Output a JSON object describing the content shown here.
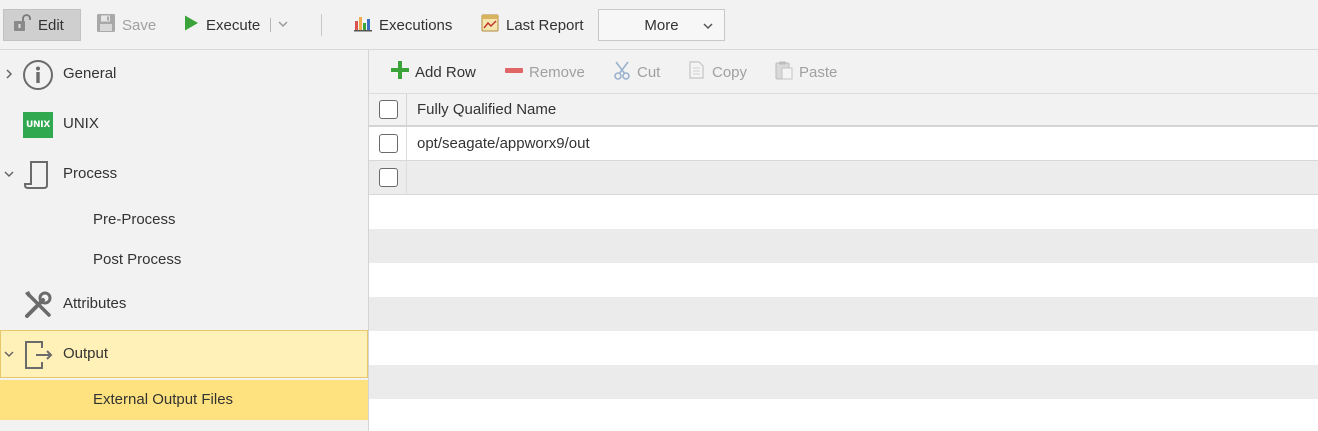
{
  "toolbar": {
    "edit": "Edit",
    "save": "Save",
    "execute": "Execute",
    "executions": "Executions",
    "last_report": "Last Report",
    "more": "More"
  },
  "sidebar": {
    "items": [
      {
        "label": "General",
        "icon": "info-icon"
      },
      {
        "label": "UNIX",
        "icon": "unix-icon",
        "badge": "UNIX"
      },
      {
        "label": "Process",
        "icon": "process-icon"
      },
      {
        "label": "Pre-Process"
      },
      {
        "label": "Post Process"
      },
      {
        "label": "Attributes",
        "icon": "tools-icon"
      },
      {
        "label": "Output",
        "icon": "output-icon"
      },
      {
        "label": "External Output Files"
      }
    ]
  },
  "subtoolbar": {
    "add_row": "Add Row",
    "remove": "Remove",
    "cut": "Cut",
    "copy": "Copy",
    "paste": "Paste"
  },
  "grid": {
    "column_header": "Fully Qualified Name",
    "rows": [
      "opt/seagate/appworx9/out"
    ]
  },
  "colors": {
    "selected_item": "#fde27f",
    "active_item": "#fff1b8",
    "add_green": "#3aa43a",
    "remove_red": "#e06666",
    "unix_green": "#2fa84f"
  }
}
